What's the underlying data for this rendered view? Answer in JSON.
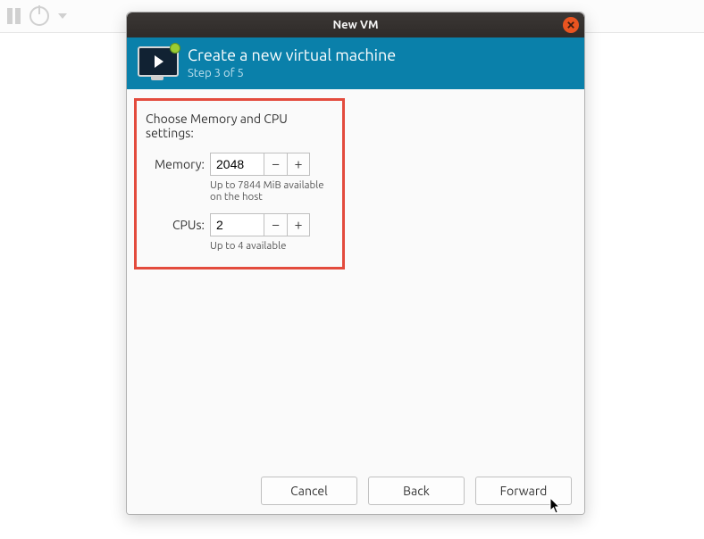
{
  "host_toolbar": {
    "pause_icon": "pause-icon",
    "power_icon": "power-icon",
    "dropdown_icon": "dropdown-caret-icon"
  },
  "dialog": {
    "title": "New VM",
    "close_icon": "close-icon",
    "banner": {
      "icon": "vm-monitor-icon",
      "heading": "Create a new virtual machine",
      "step_text": "Step 3 of 5"
    },
    "content": {
      "section_label": "Choose Memory and CPU settings:",
      "memory": {
        "label": "Memory:",
        "value": "2048",
        "minus": "−",
        "plus": "+",
        "hint": "Up to 7844 MiB available on the host"
      },
      "cpus": {
        "label": "CPUs:",
        "value": "2",
        "minus": "−",
        "plus": "+",
        "hint": "Up to 4 available"
      }
    },
    "buttons": {
      "cancel": "Cancel",
      "back": "Back",
      "forward": "Forward"
    }
  }
}
